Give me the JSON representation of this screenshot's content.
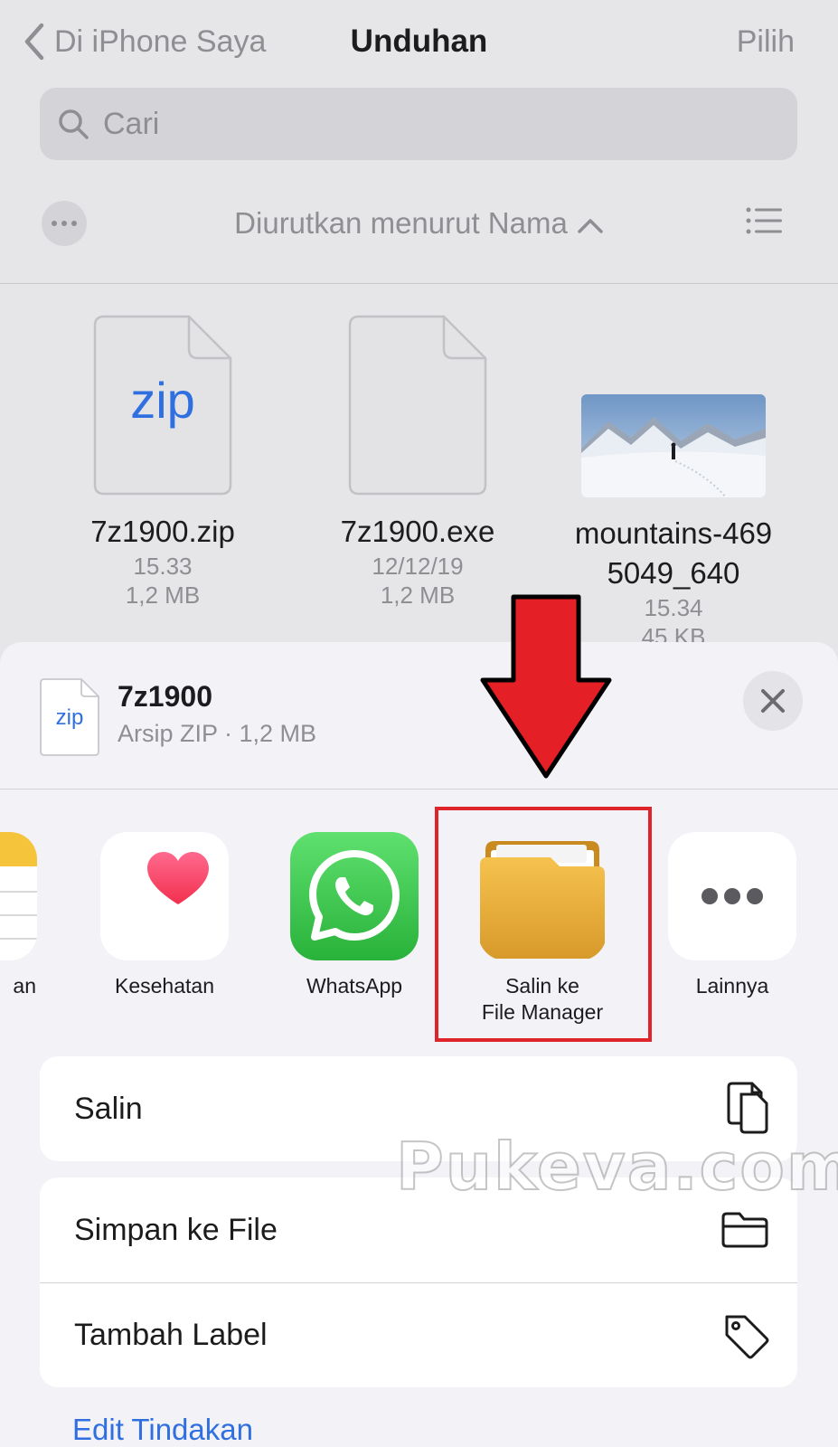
{
  "nav": {
    "back_label": "Di iPhone Saya",
    "title": "Unduhan",
    "select_label": "Pilih"
  },
  "search": {
    "placeholder": "Cari"
  },
  "sort": {
    "label": "Diurutkan menurut Nama"
  },
  "files": [
    {
      "name": "7z1900.zip",
      "meta1": "15.33",
      "meta2": "1,2 MB",
      "icon": "zip-file-icon",
      "icon_text": "zip"
    },
    {
      "name": "7z1900.exe",
      "meta1": "12/12/19",
      "meta2": "1,2 MB",
      "icon": "blank-file-icon"
    },
    {
      "name_line1": "mountains-469",
      "name_line2": "5049_640",
      "meta1": "15.34",
      "meta2": "45 KB",
      "icon": "image-thumbnail"
    }
  ],
  "sheet": {
    "file_name": "7z1900",
    "file_info": "Arsip ZIP · 1,2 MB",
    "icon_text": "zip",
    "apps": [
      {
        "label": "an",
        "icon": "notes-icon"
      },
      {
        "label": "Kesehatan",
        "icon": "health-heart-icon"
      },
      {
        "label": "WhatsApp",
        "icon": "whatsapp-icon"
      },
      {
        "label_line1": "Salin ke",
        "label_line2": "File Manager",
        "icon": "folder-icon"
      },
      {
        "label": "Lainnya",
        "icon": "more-dots-icon"
      }
    ],
    "actions": [
      {
        "label": "Salin",
        "icon": "copy-icon"
      },
      {
        "label": "Simpan ke File",
        "icon": "folder-outline-icon"
      },
      {
        "label": "Tambah Label",
        "icon": "tag-icon"
      }
    ],
    "edit_label": "Edit Tindakan"
  },
  "watermark": "Pukeva.com",
  "colors": {
    "accent": "#2f6fe0",
    "annotation": "#e0242b",
    "whatsapp": "#35c748",
    "folder": "#e8ac3c"
  }
}
